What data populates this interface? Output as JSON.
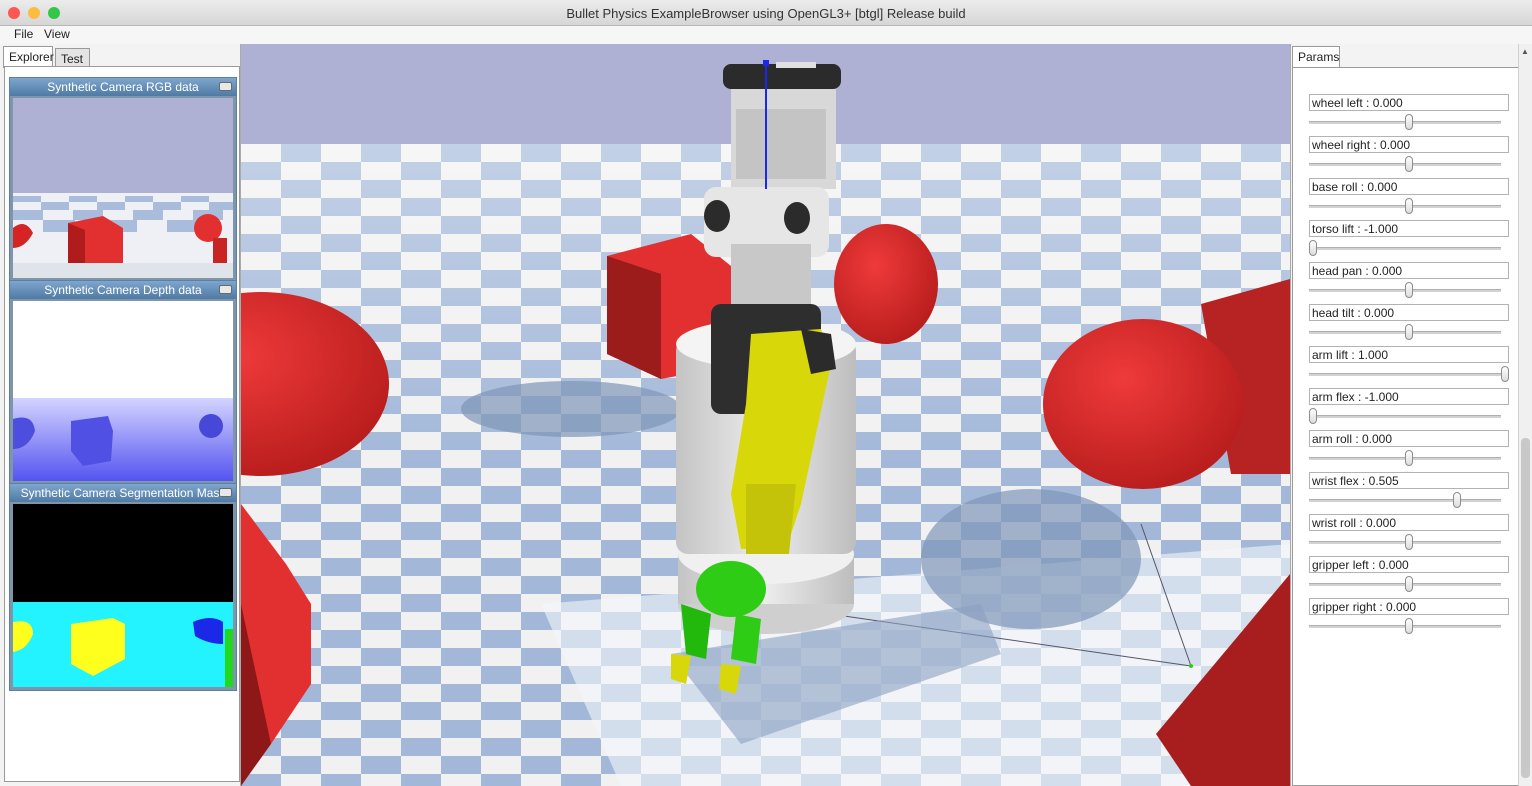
{
  "window": {
    "title": "Bullet Physics ExampleBrowser using OpenGL3+ [btgl] Release build"
  },
  "menu": {
    "file": "File",
    "view": "View"
  },
  "left_panel": {
    "tabs": [
      {
        "label": "Explorer"
      },
      {
        "label": "Test"
      }
    ],
    "camera_windows": [
      {
        "title": "Synthetic Camera RGB data"
      },
      {
        "title": "Synthetic Camera Depth data"
      },
      {
        "title": "Synthetic Camera Segmentation Mask"
      }
    ]
  },
  "right_panel": {
    "tab": "Params",
    "params": [
      {
        "label": "wheel left : 0.000",
        "value": 0.0,
        "min": -1,
        "max": 1
      },
      {
        "label": "wheel right : 0.000",
        "value": 0.0,
        "min": -1,
        "max": 1
      },
      {
        "label": "base roll : 0.000",
        "value": 0.0,
        "min": -1,
        "max": 1
      },
      {
        "label": "torso lift : -1.000",
        "value": -1.0,
        "min": -1,
        "max": 1
      },
      {
        "label": "head pan : 0.000",
        "value": 0.0,
        "min": -1,
        "max": 1
      },
      {
        "label": "head tilt : 0.000",
        "value": 0.0,
        "min": -1,
        "max": 1
      },
      {
        "label": "arm lift : 1.000",
        "value": 1.0,
        "min": -1,
        "max": 1
      },
      {
        "label": "arm flex : -1.000",
        "value": -1.0,
        "min": -1,
        "max": 1
      },
      {
        "label": "arm roll : 0.000",
        "value": 0.0,
        "min": -1,
        "max": 1
      },
      {
        "label": "wrist flex : 0.505",
        "value": 0.505,
        "min": -1,
        "max": 1
      },
      {
        "label": "wrist roll : 0.000",
        "value": 0.0,
        "min": -1,
        "max": 1
      },
      {
        "label": "gripper left : 0.000",
        "value": 0.0,
        "min": -1,
        "max": 1
      },
      {
        "label": "gripper right : 0.000",
        "value": 0.0,
        "min": -1,
        "max": 1
      }
    ]
  },
  "colors": {
    "sky": "#aeb1d3",
    "floor_light": "#f1f1f2",
    "floor_blue": "#9fb5d7",
    "red_object": "#e23030",
    "robot_yellow": "#d8d70a",
    "robot_green": "#2ecc14",
    "seg_cyan": "#23f2ff",
    "seg_yellow": "#ffff1e",
    "seg_blue": "#1c28e8",
    "close": "#fc5753",
    "minimize": "#fdbc40",
    "maximize": "#33c748"
  }
}
